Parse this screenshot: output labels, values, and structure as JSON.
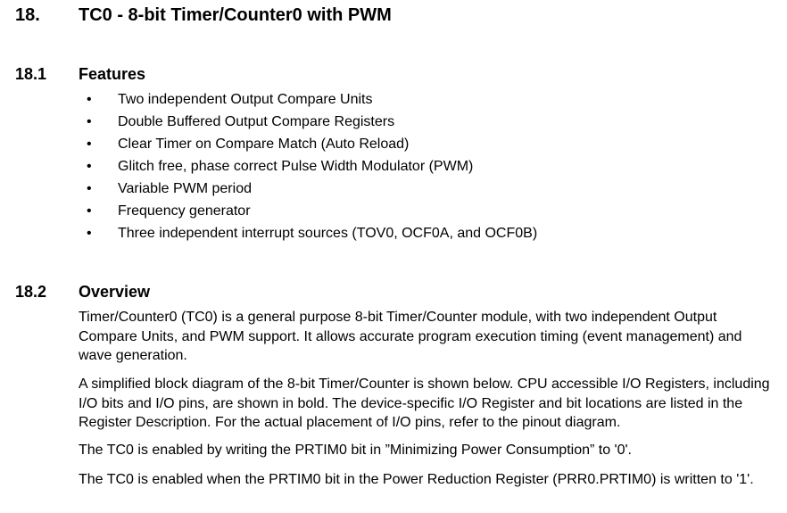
{
  "section": {
    "number": "18.",
    "title": "TC0 - 8-bit Timer/Counter0 with PWM"
  },
  "features": {
    "number": "18.1",
    "title": "Features",
    "bullet": "•",
    "items": [
      "Two independent Output Compare Units",
      "Double Buffered Output Compare Registers",
      "Clear Timer on Compare Match (Auto Reload)",
      "Glitch free, phase correct Pulse Width Modulator (PWM)",
      "Variable PWM period",
      "Frequency generator",
      "Three independent interrupt sources (TOV0, OCF0A, and OCF0B)"
    ]
  },
  "overview": {
    "number": "18.2",
    "title": "Overview",
    "paragraphs": [
      "Timer/Counter0 (TC0) is a general purpose 8-bit Timer/Counter module, with two independent Output Compare Units, and PWM support. It allows accurate program execution timing (event management) and wave generation.",
      "A simplified block diagram of the 8-bit Timer/Counter is shown below. CPU accessible I/O Registers, including I/O bits and I/O pins, are shown in bold. The device-specific I/O Register and bit locations are listed in the Register Description. For the actual placement of I/O pins, refer to the pinout diagram.",
      "The TC0 is enabled by writing the PRTIM0 bit in ”Minimizing Power Consumption” to '0'.",
      "The TC0 is enabled when the PRTIM0 bit in the Power Reduction Register (PRR0.PRTIM0) is written to '1'."
    ]
  }
}
